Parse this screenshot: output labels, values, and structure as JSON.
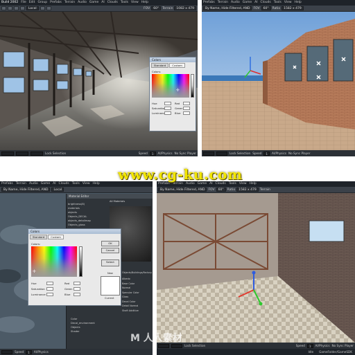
{
  "watermark": {
    "text": "www.cg-ku.com"
  },
  "bottom_logo": {
    "text": "M 人人素材"
  },
  "panel_tl": {
    "title": "Build 2002",
    "menu": [
      "File",
      "Edit",
      "Group",
      "Prefabs",
      "Terrain",
      "Audio",
      "Game",
      "AI",
      "Clouds",
      "Tools",
      "View",
      "Help"
    ],
    "toolbar": {
      "by_name": "Local",
      "fov": "FOV",
      "fov_value": "60°",
      "terrain": "Terrain",
      "random": "Random",
      "random_value": "1082 x 479"
    },
    "status": {
      "lock_selection": "Lock Selection",
      "speed": "Speed",
      "speed_value": "1",
      "mode": "AI/Physics",
      "game_mode": "No Sync Player"
    },
    "colors_dialog": {
      "title": "Colors",
      "tabs": [
        "Standard",
        "Custom"
      ],
      "colors_label": "Colors:",
      "fields": [
        {
          "label": "Hue",
          "value": ""
        },
        {
          "label": "Saturation",
          "value": ""
        },
        {
          "label": "Luminance",
          "value": ""
        }
      ],
      "fields_right": [
        {
          "label": "Red",
          "value": ""
        },
        {
          "label": "Green",
          "value": ""
        },
        {
          "label": "Blue",
          "value": ""
        }
      ]
    }
  },
  "panel_tr": {
    "toolbar": {
      "by_name": "By Name, Hide Filtered, AND",
      "fov": "FOV",
      "fov_value": "60°",
      "ratio": "Ratio",
      "ratio_value": "1582 x 479",
      "terrain": "Terrain"
    },
    "status": {
      "lock_selection": "Lock Selection",
      "speed": "Speed",
      "speed_value": "1",
      "mode": "AI/Physics",
      "game_mode": "No Sync Player"
    }
  },
  "panel_bl": {
    "menu": [
      "Prefabs",
      "Terrain",
      "Audio",
      "Game",
      "AI",
      "Clouds",
      "Tools",
      "View",
      "Help"
    ],
    "toolbar": {
      "by_name": "By Name, Hide Filtered, AND",
      "local": "Local"
    },
    "material_editor": {
      "title": "Material Editor",
      "items": [
        "brightness(8)",
        "materials",
        "objects",
        "Objects_DECAL",
        "objects_detailmap",
        "Objects_gloss"
      ],
      "right_items": [
        "Albedo",
        "Base Color",
        "Normal",
        "Specular Color",
        "Gloss",
        "Decal Color",
        "Detail Normal",
        "Shaft Additive"
      ],
      "path": "Objects/Buildings/Factory",
      "bottom_items": [
        "Color",
        "Decal_environment",
        "Objects",
        "Shader"
      ],
      "all_materials": "All Materials"
    },
    "colors_dialog": {
      "title": "Colors",
      "tabs": [
        "Standard",
        "Custom"
      ],
      "colors_label": "Colors:",
      "ok": "OK",
      "cancel": "Cancel",
      "select": "Select",
      "new_label": "New",
      "current_label": "Current",
      "fields": [
        {
          "label": "Hue",
          "value": ""
        },
        {
          "label": "Saturation",
          "value": ""
        },
        {
          "label": "Luminance",
          "value": ""
        }
      ],
      "fields_right": [
        {
          "label": "Red",
          "value": ""
        },
        {
          "label": "Green",
          "value": ""
        },
        {
          "label": "Blue",
          "value": ""
        }
      ]
    },
    "status": {
      "speed": "Speed",
      "speed_value": "1",
      "mode": "AI/Physics"
    }
  },
  "panel_br": {
    "menu": [
      "Prefabs",
      "Terrain",
      "Audio",
      "Game",
      "AI",
      "Clouds",
      "Tools",
      "View",
      "Help"
    ],
    "toolbar": {
      "by_name": "By Name, Hide Filtered, AND",
      "fov": "FOV",
      "fov_value": "60°",
      "ratio": "Ratio",
      "ratio_value": "1582 x 479",
      "terrain": "Terrain"
    },
    "status": {
      "lock_selection": "Lock Selection",
      "speed": "Speed",
      "speed_value": "1",
      "mode": "AI/Physics",
      "game_mode": "No Sync Player"
    },
    "footer": {
      "idle": "Idle",
      "path": "GameFolder/GameSDK"
    }
  },
  "colors": {
    "accent_dark": "#1e2329",
    "watermark_yellow": "#f2e600",
    "divider": "#ffffff"
  }
}
